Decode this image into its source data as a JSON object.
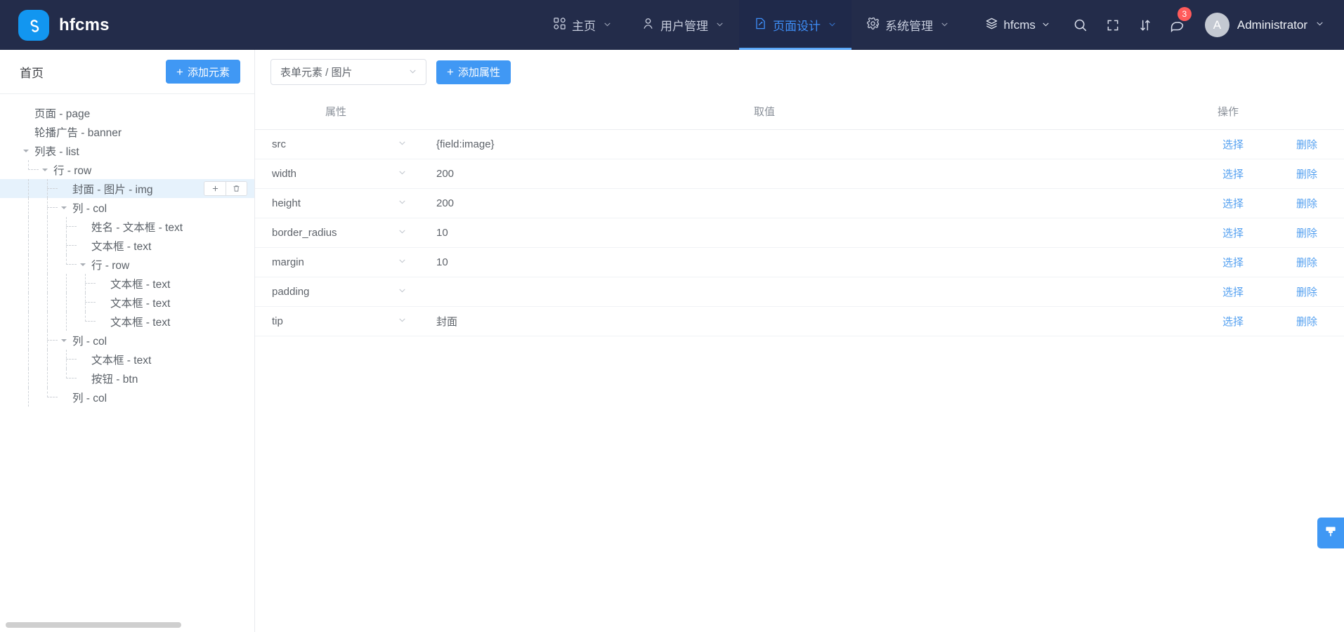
{
  "app": {
    "brand_name": "hfcms",
    "logo_icon": "hfcms-s-logo-icon"
  },
  "nav": {
    "items": [
      {
        "label": "主页",
        "icon": "grid-apps-icon",
        "active": false,
        "has_caret": true
      },
      {
        "label": "用户管理",
        "icon": "user-icon",
        "active": false,
        "has_caret": true
      },
      {
        "label": "页面设计",
        "icon": "document-edit-icon",
        "active": true,
        "has_caret": true
      },
      {
        "label": "系统管理",
        "icon": "gear-icon",
        "active": false,
        "has_caret": true
      }
    ],
    "site_switcher": {
      "label": "hfcms",
      "icon": "layers-icon"
    },
    "icons": [
      {
        "name": "search-icon"
      },
      {
        "name": "fullscreen-icon"
      },
      {
        "name": "sort-arrows-icon"
      },
      {
        "name": "message-icon",
        "badge": "3"
      }
    ],
    "user": {
      "avatar_letter": "A",
      "name": "Administrator"
    },
    "accent_active_color": "#3e8ef7",
    "bar_color": "#232c4a",
    "badge_color": "#ff5b5b"
  },
  "sidebar": {
    "title": "首页",
    "add_element_button": {
      "label": "添加元素",
      "plus": "+"
    },
    "selected_actions": {
      "add_icon": "plus-icon",
      "delete_icon": "trash-icon"
    },
    "tree": [
      {
        "label": "页面 - page",
        "depth": 0,
        "caret": "none",
        "selected": false
      },
      {
        "label": "轮播广告 - banner",
        "depth": 0,
        "caret": "none",
        "selected": false
      },
      {
        "label": "列表 - list",
        "depth": 0,
        "caret": "expanded",
        "selected": false
      },
      {
        "label": "行 - row",
        "depth": 1,
        "caret": "expanded",
        "selected": false
      },
      {
        "label": "封面 - 图片 - img",
        "depth": 2,
        "caret": "none",
        "selected": true
      },
      {
        "label": "列 - col",
        "depth": 2,
        "caret": "expanded",
        "selected": false
      },
      {
        "label": "姓名 - 文本框 - text",
        "depth": 3,
        "caret": "none",
        "selected": false
      },
      {
        "label": "文本框 - text",
        "depth": 3,
        "caret": "none",
        "selected": false
      },
      {
        "label": "行 - row",
        "depth": 3,
        "caret": "expanded",
        "selected": false
      },
      {
        "label": "文本框 - text",
        "depth": 4,
        "caret": "none",
        "selected": false
      },
      {
        "label": "文本框 - text",
        "depth": 4,
        "caret": "none",
        "selected": false
      },
      {
        "label": "文本框 - text",
        "depth": 4,
        "caret": "none",
        "selected": false
      },
      {
        "label": "列 - col",
        "depth": 2,
        "caret": "expanded",
        "selected": false
      },
      {
        "label": "文本框 - text",
        "depth": 3,
        "caret": "none",
        "selected": false
      },
      {
        "label": "按钮 - btn",
        "depth": 3,
        "caret": "none",
        "selected": false
      },
      {
        "label": "列 - col",
        "depth": 2,
        "caret": "none",
        "selected": false
      }
    ]
  },
  "main": {
    "element_select": {
      "value": "表单元素 / 图片"
    },
    "add_attribute_button": {
      "label": "添加属性",
      "plus": "+"
    },
    "table": {
      "headers": [
        "属性",
        "取值",
        "操作"
      ],
      "rows": [
        {
          "attr": "src",
          "value": "{field:image}",
          "select": "选择",
          "delete": "删除"
        },
        {
          "attr": "width",
          "value": "200",
          "select": "选择",
          "delete": "删除"
        },
        {
          "attr": "height",
          "value": "200",
          "select": "选择",
          "delete": "删除"
        },
        {
          "attr": "border_radius",
          "value": "10",
          "select": "选择",
          "delete": "删除"
        },
        {
          "attr": "margin",
          "value": "10",
          "select": "选择",
          "delete": "删除"
        },
        {
          "attr": "padding",
          "value": "",
          "select": "选择",
          "delete": "删除"
        },
        {
          "attr": "tip",
          "value": "封面",
          "select": "选择",
          "delete": "删除"
        }
      ]
    },
    "theme_fab": {
      "icon": "paint-brush-icon",
      "color": "#4098f4"
    }
  }
}
